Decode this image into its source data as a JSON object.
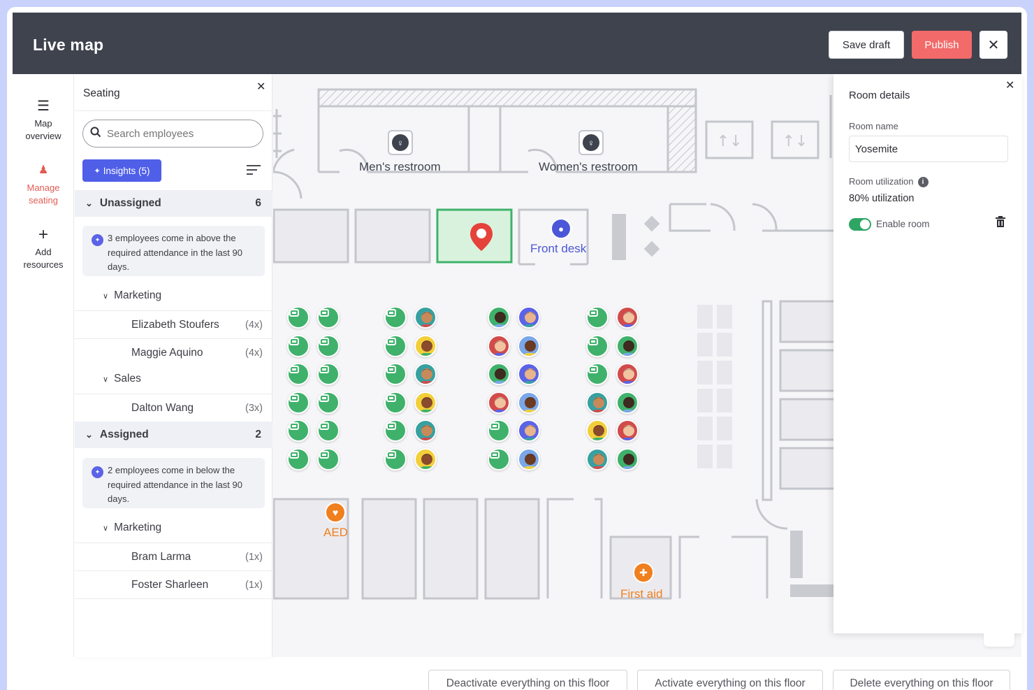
{
  "header": {
    "title": "Live map",
    "save_draft": "Save draft",
    "publish": "Publish",
    "close": "✕"
  },
  "rail": {
    "items": [
      {
        "label": "Map overview",
        "icon": "hamburger-icon",
        "glyph": "☰"
      },
      {
        "label": "Manage seating",
        "icon": "people-icon",
        "glyph": "♟"
      },
      {
        "label": "Add resources",
        "icon": "plus-icon",
        "glyph": "+"
      }
    ]
  },
  "seating": {
    "title": "Seating",
    "close": "✕",
    "search_placeholder": "Search employees",
    "insights_label": "Insights (5)",
    "groups": [
      {
        "label": "Unassigned",
        "count": "6",
        "note": "3 employees come in above the required attendance in the last 90 days.",
        "subgroups": [
          {
            "label": "Marketing",
            "employees": [
              {
                "name": "Elizabeth Stoufers",
                "count": "(4x)"
              },
              {
                "name": "Maggie Aquino",
                "count": "(4x)"
              }
            ]
          },
          {
            "label": "Sales",
            "employees": [
              {
                "name": "Dalton Wang",
                "count": "(3x)"
              }
            ]
          }
        ]
      },
      {
        "label": "Assigned",
        "count": "2",
        "note": "2 employees come in below the required attendance in the last 90 days.",
        "subgroups": [
          {
            "label": "Marketing",
            "employees": [
              {
                "name": "Bram Larma",
                "count": "(1x)"
              },
              {
                "name": "Foster Sharleen",
                "count": "(1x)"
              }
            ]
          }
        ]
      }
    ]
  },
  "map": {
    "labels": {
      "mens_restroom": "Men's restroom",
      "womens_restroom": "Women's restroom",
      "front_desk": "Front desk",
      "aed": "AED",
      "first_aid": "First aid"
    },
    "colors": {
      "desk_green": "#3fb16b",
      "selected_room": "#d9f2de",
      "pin_red": "#e5423b",
      "front_desk_blue": "#4b57d8",
      "safety_orange": "#f07f1e"
    }
  },
  "room_details": {
    "title": "Room details",
    "close": "✕",
    "room_name_label": "Room name",
    "room_name_value": "Yosemite",
    "utilization_label": "Room utilization",
    "utilization_value": "80% utilization",
    "enable_label": "Enable room",
    "enabled": true
  },
  "footer": {
    "deactivate": "Deactivate everything on this floor",
    "activate": "Activate everything on this floor",
    "delete": "Delete everything on this floor"
  }
}
